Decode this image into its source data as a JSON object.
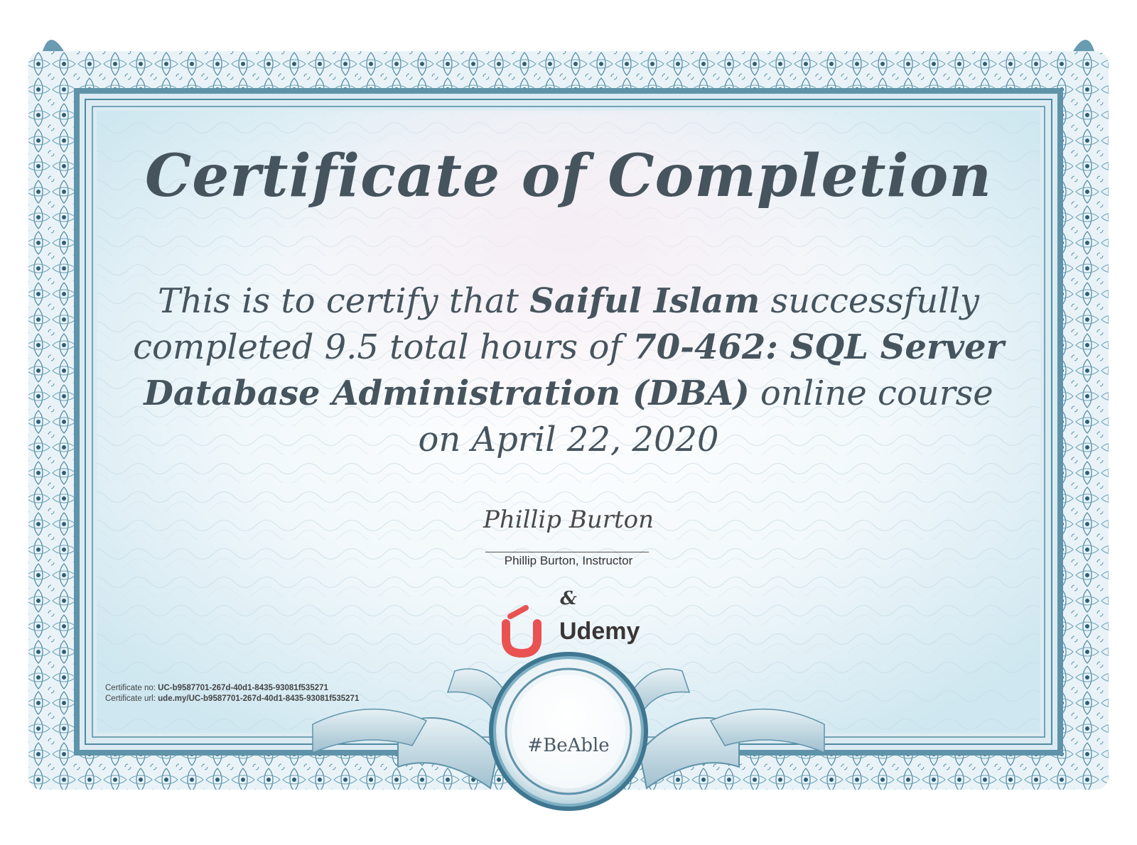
{
  "certificate": {
    "title": "Certificate of Completion",
    "statement": {
      "prefix": "This is to certify that ",
      "student_name": "Saiful Islam",
      "middle": " successfully completed 9.5 total hours of ",
      "course_name": "70-462: SQL Server Database Administration (DBA)",
      "suffix": " online course on April 22, 2020"
    },
    "signature": "Phillip Burton",
    "signature_caption": "Phillip Burton, Instructor",
    "ampersand": "&",
    "brand": "Udemy",
    "certificate_no_label": "Certificate no: ",
    "certificate_no": "UC-b9587701-267d-40d1-8435-93081f535271",
    "certificate_url_label": "Certificate url: ",
    "certificate_url": "ude.my/UC-b9587701-267d-40d1-8435-93081f535271",
    "seal_text": "#BeAble"
  },
  "colors": {
    "frame": "#4f8aa3",
    "frame_dark": "#2f5f77",
    "text": "#46545e",
    "brand_red": "#ea5252"
  },
  "icons": {
    "border": "guilloche-border",
    "logo": "udemy-logo-mark",
    "seal": "ribbon-seal"
  }
}
